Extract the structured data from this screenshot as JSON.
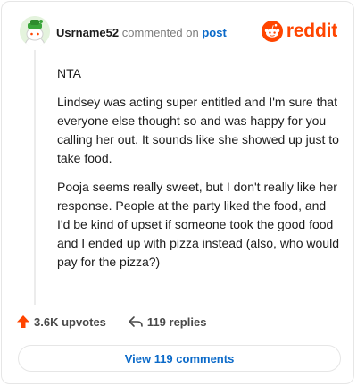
{
  "comment": {
    "username": "Usrname52",
    "commented_on_text": "commented on",
    "post_link": "post",
    "paragraphs": [
      "NTA",
      "Lindsey was acting super entitled and I'm sure that everyone else thought so and was happy for you calling her out. It sounds like she showed up just to take food.",
      "Pooja seems really sweet, but I don't really like her response. People at the party liked the food, and I'd be kind of upset if someone took the good food and I ended up with pizza instead (also, who would pay for the pizza?)"
    ]
  },
  "brand": {
    "name": "reddit",
    "color": "#ff4500"
  },
  "actions": {
    "upvotes": "3.6K upvotes",
    "replies": "119 replies"
  },
  "view_button": {
    "label": "View 119 comments"
  },
  "icons": [
    "avatar-icon",
    "reddit-logo-icon",
    "upvote-arrow-icon",
    "reply-arrow-icon"
  ]
}
